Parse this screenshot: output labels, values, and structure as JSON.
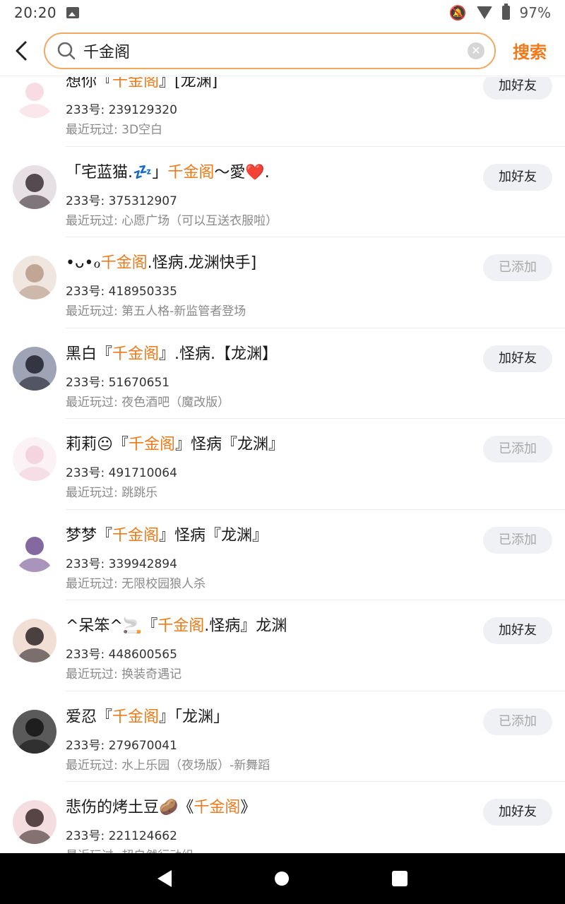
{
  "status_bar": {
    "time": "20:20",
    "battery": "97%"
  },
  "header": {
    "search_value": "千金阁",
    "search_button": "搜索"
  },
  "labels": {
    "add": "加好友",
    "added": "已添加"
  },
  "colors": {
    "accent": "#f07a1a",
    "search_border": "#f3a862"
  },
  "results": [
    {
      "name_pre": "想你『",
      "name_hl": "千金阁",
      "name_post": "』[龙渊]",
      "uid": "233号: 239129320",
      "recent": "最近玩过: 3D空白",
      "status": "add",
      "avatar_colors": [
        "#f6d7de",
        "#ffffff"
      ]
    },
    {
      "name_pre": "「宅蓝猫.💤」",
      "name_hl": "千金阁",
      "name_post": "〜愛❤️.",
      "uid": "233号: 375312907",
      "recent": "最近玩过: 心愿广场（可以互送衣服啦）",
      "status": "add",
      "avatar_colors": [
        "#3a3036",
        "#e6dfe3"
      ]
    },
    {
      "name_pre": "•ᴗ•ℴ",
      "name_hl": "千金阁",
      "name_post": ".怪病.龙渊快手]",
      "uid": "233号: 418950335",
      "recent": "最近玩过: 第五人格-新监管者登场",
      "status": "added",
      "avatar_colors": [
        "#b89a8a",
        "#efe6df"
      ]
    },
    {
      "name_pre": "黑白『",
      "name_hl": "千金阁",
      "name_post": "』.怪病.【龙渊】",
      "uid": "233号: 51670651",
      "recent": "最近玩过: 夜色酒吧（魔改版）",
      "status": "add",
      "avatar_colors": [
        "#20222e",
        "#9ea3b5"
      ]
    },
    {
      "name_pre": "莉莉😐『",
      "name_hl": "千金阁",
      "name_post": "』怪病『龙渊』",
      "uid": "233号: 491710064",
      "recent": "最近玩过: 跳跳乐",
      "status": "added",
      "avatar_colors": [
        "#f2d0da",
        "#fbf2f5"
      ]
    },
    {
      "name_pre": "梦梦『",
      "name_hl": "千金阁",
      "name_post": "』怪病『龙渊』",
      "uid": "233号: 339942894",
      "recent": "最近玩过: 无限校园狼人杀",
      "status": "added",
      "avatar_colors": [
        "#6f4e8f",
        "#ffffff"
      ]
    },
    {
      "name_pre": "^呆笨^🚬『",
      "name_hl": "千金阁",
      "name_post": ".怪病』龙渊",
      "uid": "233号: 448600565",
      "recent": "最近玩过: 换装奇遇记",
      "status": "add",
      "avatar_colors": [
        "#2b2524",
        "#f1dfd6"
      ]
    },
    {
      "name_pre": "爱忍『",
      "name_hl": "千金阁",
      "name_post": "』「龙渊」",
      "uid": "233号: 279670041",
      "recent": "最近玩过: 水上乐园（夜场版）-新舞蹈",
      "status": "added",
      "avatar_colors": [
        "#141414",
        "#5a5a5a"
      ]
    },
    {
      "name_pre": "悲伤的烤土豆🥔《",
      "name_hl": "千金阁",
      "name_post": "》",
      "uid": "233号: 221124662",
      "recent": "最近玩过: 超自然行动组",
      "status": "add",
      "avatar_colors": [
        "#3a2a28",
        "#f3dde1"
      ]
    }
  ]
}
